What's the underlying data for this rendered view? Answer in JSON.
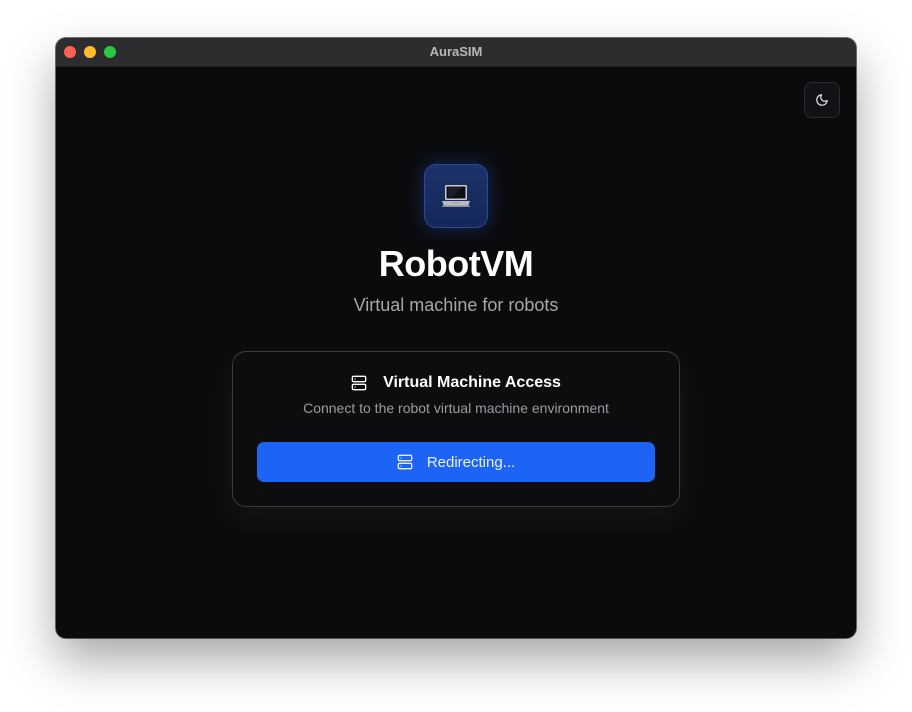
{
  "window": {
    "title": "AuraSIM"
  },
  "toolbar": {
    "theme_toggle_icon": "moon-icon"
  },
  "hero": {
    "app_icon": "laptop-icon",
    "app_name": "RobotVM",
    "tagline": "Virtual machine for robots"
  },
  "access_card": {
    "icon": "server-icon",
    "title": "Virtual Machine Access",
    "description": "Connect to the robot virtual machine environment",
    "button": {
      "icon": "server-icon",
      "label": "Redirecting..."
    }
  },
  "colors": {
    "background": "#0b0b0e",
    "accent": "#1d63f5",
    "titlebar": "#2d2d30",
    "traffic_close": "#ff5f57",
    "traffic_minimize": "#febc2e",
    "traffic_maximize": "#28c840"
  }
}
